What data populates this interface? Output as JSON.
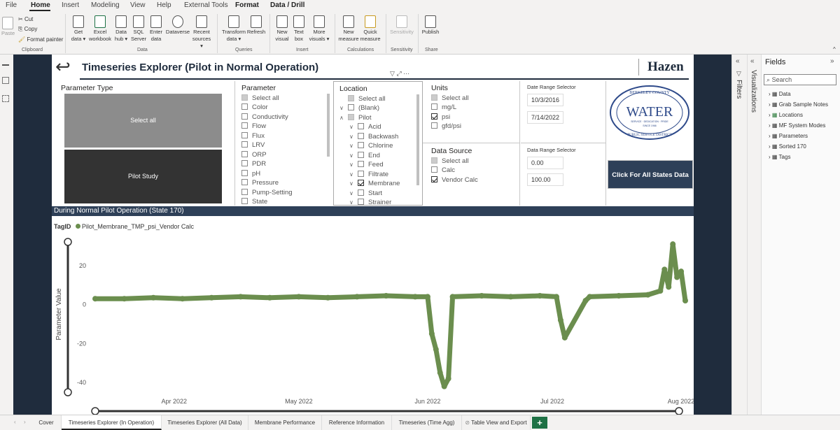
{
  "menu": {
    "items": [
      "File",
      "Home",
      "Insert",
      "Modeling",
      "View",
      "Help",
      "External Tools",
      "Format",
      "Data / Drill"
    ],
    "active": "Home"
  },
  "ribbon": {
    "clipboard": {
      "paste": "Paste",
      "cut": "Cut",
      "copy": "Copy",
      "format_painter": "Format painter",
      "group": "Clipboard"
    },
    "data": {
      "get_data": "Get",
      "get_data2": "data ▾",
      "excel": "Excel",
      "excel2": "workbook",
      "datahub": "Data",
      "datahub2": "hub ▾",
      "sql": "SQL",
      "sql2": "Server",
      "enter": "Enter",
      "enter2": "data",
      "dataverse": "Dataverse",
      "recent": "Recent",
      "recent2": "sources ▾",
      "group": "Data"
    },
    "queries": {
      "transform": "Transform",
      "transform2": "data ▾",
      "refresh": "Refresh",
      "group": "Queries"
    },
    "insert": {
      "newvisual": "New",
      "newvisual2": "visual",
      "textbox": "Text",
      "textbox2": "box",
      "more": "More",
      "more2": "visuals ▾",
      "group": "Insert"
    },
    "calc": {
      "newmeasure": "New",
      "newmeasure2": "measure",
      "quick": "Quick",
      "quick2": "measure",
      "group": "Calculations"
    },
    "sensitivity": {
      "label": "Sensitivity",
      "group": "Sensitivity"
    },
    "share": {
      "publish": "Publish",
      "group": "Share"
    }
  },
  "report": {
    "title": "Timeseries Explorer (Pilot in Normal Operation)",
    "logo_text": "Hazen",
    "water_logo": {
      "top": "BERKELEY COUNTY",
      "main": "WATER",
      "sub": "SERVICE · DEDICATION · PRIDE",
      "since": "SINCE 1966",
      "bottom": "PUBLIC SERVICE DISTRICT"
    },
    "all_states_button": "Click For All States Data",
    "section_header": "During Normal Pilot Operation (State 170)",
    "param_type": {
      "title": "Parameter Type",
      "btn1": "Select all",
      "btn2": "Pilot Study"
    },
    "parameter": {
      "title": "Parameter",
      "items": [
        "Select all",
        "Color",
        "Conductivity",
        "Flow",
        "Flux",
        "LRV",
        "ORP",
        "PDR",
        "pH",
        "Pressure",
        "Pump-Setting",
        "State"
      ]
    },
    "location": {
      "title": "Location",
      "items": [
        "Select all",
        "(Blank)",
        "Pilot",
        "Acid",
        "Backwash",
        "Chlorine",
        "End",
        "Feed",
        "Filtrate",
        "Membrane",
        "Start",
        "Strainer"
      ]
    },
    "units": {
      "title": "Units",
      "items": [
        "Select all",
        "mg/L",
        "psi",
        "gfd/psi"
      ]
    },
    "data_source": {
      "title": "Data Source",
      "items": [
        "Select all",
        "Calc",
        "Vendor Calc"
      ]
    },
    "date_range1": {
      "label": "Date Range Selector",
      "start": "10/3/2016",
      "end": "7/14/2022"
    },
    "date_range2": {
      "label": "Data Range Selector",
      "min": "0.00",
      "max": "100.00"
    }
  },
  "chart_data": {
    "type": "scatter",
    "legend_title": "TagID",
    "series": [
      {
        "name": "Pilot_Membrane_TMP_psi_Vendor Calc",
        "color": "#6b8e4e"
      }
    ],
    "ylabel": "Parameter Value",
    "y_ticks": [
      20,
      0,
      -20,
      -40
    ],
    "x_ticks": [
      "Apr 2022",
      "May 2022",
      "Jun 2022",
      "Jul 2022",
      "Aug 2022"
    ],
    "ylim": [
      -45,
      35
    ],
    "xlim": [
      "2022-03-13",
      "2022-08-02"
    ],
    "points": [
      [
        "2022-03-13",
        3
      ],
      [
        "2022-03-20",
        3
      ],
      [
        "2022-03-27",
        3.5
      ],
      [
        "2022-04-03",
        3
      ],
      [
        "2022-04-10",
        3.5
      ],
      [
        "2022-04-17",
        4
      ],
      [
        "2022-04-24",
        3.5
      ],
      [
        "2022-05-01",
        4
      ],
      [
        "2022-05-08",
        3.5
      ],
      [
        "2022-05-15",
        4
      ],
      [
        "2022-05-22",
        4.5
      ],
      [
        "2022-05-29",
        4
      ],
      [
        "2022-06-01",
        4
      ],
      [
        "2022-06-02",
        -15
      ],
      [
        "2022-06-03",
        -23
      ],
      [
        "2022-06-04",
        -35
      ],
      [
        "2022-06-05",
        -42
      ],
      [
        "2022-06-06",
        -38
      ],
      [
        "2022-06-07",
        4
      ],
      [
        "2022-06-14",
        4.5
      ],
      [
        "2022-06-21",
        4
      ],
      [
        "2022-06-28",
        4.5
      ],
      [
        "2022-07-02",
        4
      ],
      [
        "2022-07-03",
        -8
      ],
      [
        "2022-07-04",
        -17
      ],
      [
        "2022-07-09",
        2
      ],
      [
        "2022-07-10",
        4
      ],
      [
        "2022-07-17",
        4.5
      ],
      [
        "2022-07-24",
        5
      ],
      [
        "2022-07-27",
        7
      ],
      [
        "2022-07-28",
        18
      ],
      [
        "2022-07-29",
        9
      ],
      [
        "2022-07-30",
        31
      ],
      [
        "2022-07-31",
        14
      ],
      [
        "2022-08-01",
        17
      ],
      [
        "2022-08-02",
        2
      ]
    ]
  },
  "fields": {
    "title": "Fields",
    "search_placeholder": "Search",
    "items": [
      "Data",
      "Grab Sample Notes",
      "Locations",
      "MF System Modes",
      "Parameters",
      "Sorted 170",
      "Tags"
    ]
  },
  "panes": {
    "filters": "Filters",
    "visualizations": "Visualizations"
  },
  "tabs": [
    "Cover",
    "Timeseries Explorer (In Operation)",
    "Timeseries Explorer (All Data)",
    "Membrane Performance",
    "Reference Information",
    "Timeseries (Time Agg)",
    "Table View and Export"
  ],
  "active_tab": "Timeseries Explorer (In Operation)",
  "add_tab": "+",
  "colors": {
    "canvas_bg": "#1f2c3d",
    "series": "#6b8e4e",
    "header": "#1f2c3d",
    "button": "#2e4058"
  }
}
